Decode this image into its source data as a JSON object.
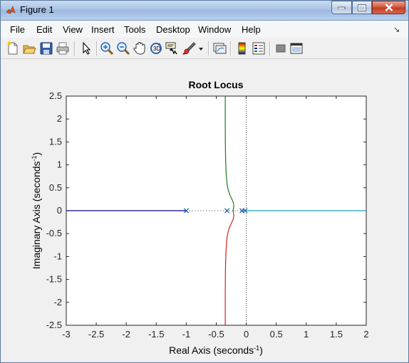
{
  "window": {
    "title": "Figure 1"
  },
  "menu": [
    "File",
    "Edit",
    "View",
    "Insert",
    "Tools",
    "Desktop",
    "Window",
    "Help"
  ],
  "toolbar_icons": [
    "new-figure-icon",
    "open-file-icon",
    "save-icon",
    "print-icon",
    "edit-plot-arrow-icon",
    "zoom-in-icon",
    "zoom-out-icon",
    "pan-hand-icon",
    "rotate-3d-icon",
    "data-cursor-icon",
    "brush-icon",
    "brush-dropdown-icon",
    "link-plot-icon",
    "insert-colorbar-icon",
    "insert-legend-icon",
    "hide-plot-tools-icon",
    "show-plot-tools-icon"
  ],
  "chart_data": {
    "type": "line",
    "title": "Root Locus",
    "xlabel_main": "Real Axis (seconds",
    "xlabel_sup": "-1",
    "xlabel_end": ")",
    "ylabel_main": "Imaginary Axis (seconds",
    "ylabel_sup": "-1",
    "ylabel_end": ")",
    "xlim": [
      -3,
      2
    ],
    "ylim": [
      -2.5,
      2.5
    ],
    "xticks": [
      "-3",
      "-2.5",
      "-2",
      "-1.5",
      "-1",
      "-0.5",
      "0",
      "0.5",
      "1",
      "1.5",
      "2"
    ],
    "yticks": [
      "2.5",
      "2",
      "1.5",
      "1",
      "0.5",
      "0",
      "-0.5",
      "-1",
      "-1.5",
      "-2",
      "-2.5"
    ],
    "grid": false,
    "poles": [
      [
        -1,
        0
      ],
      [
        -0.32,
        0
      ],
      [
        -0.07,
        0
      ],
      [
        -0.02,
        0
      ]
    ],
    "series": [
      {
        "color": "#00008b",
        "x": [
          -3,
          -1
        ],
        "y": [
          0,
          0
        ]
      },
      {
        "color": "#1e7b1e",
        "x": [
          -0.35,
          -0.35,
          -0.34,
          -0.32,
          -0.28,
          -0.2,
          -0.22
        ],
        "y": [
          2.5,
          1.5,
          0.9,
          0.55,
          0.35,
          0.15,
          0
        ]
      },
      {
        "color": "#d62020",
        "x": [
          -0.35,
          -0.35,
          -0.34,
          -0.32,
          -0.28,
          -0.2,
          -0.22
        ],
        "y": [
          -2.5,
          -1.5,
          -0.9,
          -0.55,
          -0.35,
          -0.15,
          0
        ]
      },
      {
        "color": "#17a2b8",
        "x": [
          -0.02,
          2
        ],
        "y": [
          0,
          0
        ]
      }
    ]
  }
}
